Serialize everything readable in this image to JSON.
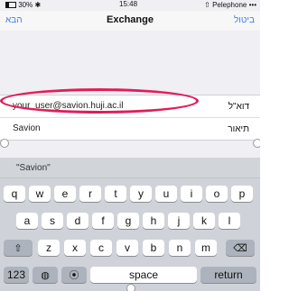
{
  "status_bar": {
    "battery": "30%",
    "time": "15:48",
    "carrier": "Pelephone"
  },
  "nav": {
    "title": "Exchange",
    "left_button": "הבא",
    "right_button": "ביטול"
  },
  "form": {
    "email": {
      "label": "דוא\"ל",
      "value": "your_user@savion.huji.ac.il"
    },
    "description": {
      "label": "תיאור",
      "value": "Savion"
    }
  },
  "keyboard": {
    "suggestion": "\"Savion\"",
    "row1": [
      "q",
      "w",
      "e",
      "r",
      "t",
      "y",
      "u",
      "i",
      "o",
      "p"
    ],
    "row2": [
      "a",
      "s",
      "d",
      "f",
      "g",
      "h",
      "j",
      "k",
      "l"
    ],
    "row3": [
      "z",
      "x",
      "c",
      "v",
      "b",
      "n",
      "m"
    ],
    "shift_icon": "shift-icon",
    "delete_icon": "backspace-icon",
    "numbers_label": "123",
    "globe_icon": "globe-icon",
    "mic_icon": "microphone-icon",
    "space_label": "space",
    "return_label": "return"
  }
}
